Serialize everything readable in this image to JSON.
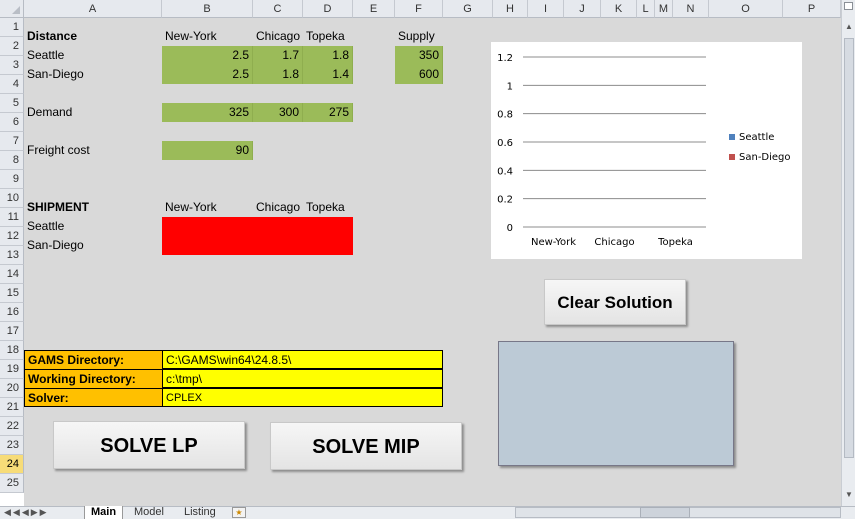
{
  "columns": [
    "A",
    "B",
    "C",
    "D",
    "E",
    "F",
    "G",
    "H",
    "I",
    "J",
    "K",
    "L",
    "M",
    "N",
    "O",
    "P"
  ],
  "rows": [
    "1",
    "2",
    "3",
    "4",
    "5",
    "6",
    "7",
    "8",
    "9",
    "10",
    "11",
    "12",
    "13",
    "14",
    "15",
    "16",
    "17",
    "18",
    "19",
    "20",
    "21",
    "22",
    "23",
    "24",
    "25"
  ],
  "active_row": "24",
  "cells": {
    "a1": "Distance",
    "b1": "New-York",
    "c1": "Chicago",
    "d1": "Topeka",
    "f1": "Supply",
    "a2": "Seattle",
    "b2": "2.5",
    "c2": "1.7",
    "d2": "1.8",
    "f2": "350",
    "a3": "San-Diego",
    "b3": "2.5",
    "c3": "1.8",
    "d3": "1.4",
    "f3": "600",
    "a5": "Demand",
    "b5": "325",
    "c5": "300",
    "d5": "275",
    "a7": "Freight cost",
    "b7": "90",
    "a10": "SHIPMENT",
    "b10": "New-York",
    "c10": "Chicago",
    "d10": "Topeka",
    "a11": "Seattle",
    "a12": "San-Diego",
    "a18": "GAMS Directory:",
    "b18": "C:\\GAMS\\win64\\24.8.5\\",
    "a19": "Working Directory:",
    "b19": "c:\\tmp\\",
    "a20": "Solver:",
    "b20": "CPLEX"
  },
  "buttons": {
    "solve_lp": "SOLVE LP",
    "solve_mip": "SOLVE MIP",
    "clear_solution": "Clear Solution"
  },
  "sheet_tabs": [
    "Main",
    "Model",
    "Listing"
  ],
  "active_sheet": "Main",
  "colors": {
    "input_green": "#9bbb59",
    "result_red": "#ff0000",
    "label_orange": "#ffc000",
    "path_yellow": "#ffff00",
    "series_seattle": "#4f81bd",
    "series_sandiego": "#c0504d",
    "panel_blue_gray": "#bccad6"
  },
  "chart_data": {
    "type": "bar",
    "categories": [
      "New-York",
      "Chicago",
      "Topeka"
    ],
    "series": [
      {
        "name": "Seattle",
        "values": [
          0,
          0,
          0
        ]
      },
      {
        "name": "San-Diego",
        "values": [
          0,
          0,
          0
        ]
      }
    ],
    "yticks": [
      "1.2",
      "1",
      "0.8",
      "0.6",
      "0.4",
      "0.2",
      "0"
    ],
    "ylim": [
      0,
      1.2
    ],
    "grid": true,
    "legend": "right"
  }
}
